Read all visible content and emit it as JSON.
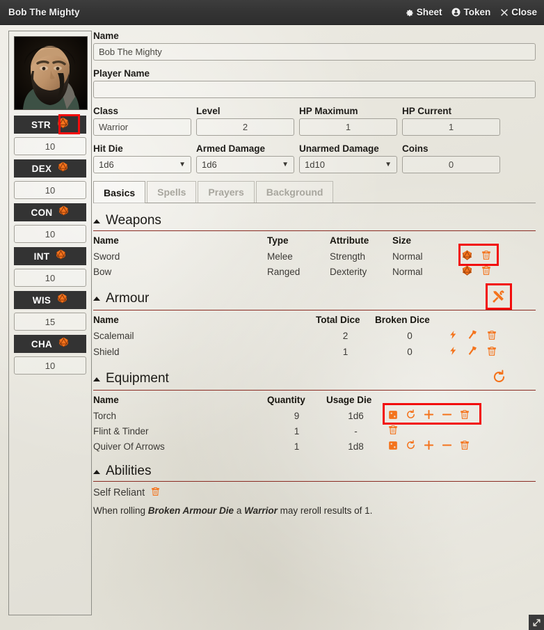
{
  "titlebar": {
    "title": "Bob The Mighty",
    "actions": [
      {
        "label": "Sheet",
        "icon": "gear-icon"
      },
      {
        "label": "Token",
        "icon": "person-icon"
      },
      {
        "label": "Close",
        "icon": "close-icon"
      }
    ]
  },
  "sidebar": {
    "portrait_alt": "character-portrait",
    "stats": [
      {
        "key": "STR",
        "value": "10"
      },
      {
        "key": "DEX",
        "value": "10"
      },
      {
        "key": "CON",
        "value": "10"
      },
      {
        "key": "INT",
        "value": "10"
      },
      {
        "key": "WIS",
        "value": "15"
      },
      {
        "key": "CHA",
        "value": "10"
      }
    ]
  },
  "form": {
    "name_label": "Name",
    "name_value": "Bob The Mighty",
    "player_name_label": "Player Name",
    "player_name_value": "",
    "class_label": "Class",
    "class_value": "Warrior",
    "level_label": "Level",
    "level_value": "2",
    "hp_max_label": "HP Maximum",
    "hp_max_value": "1",
    "hp_current_label": "HP Current",
    "hp_current_value": "1",
    "hit_die_label": "Hit Die",
    "hit_die_value": "1d6",
    "armed_damage_label": "Armed Damage",
    "armed_damage_value": "1d6",
    "unarmed_damage_label": "Unarmed Damage",
    "unarmed_damage_value": "1d10",
    "coins_label": "Coins",
    "coins_value": "0"
  },
  "tabs": [
    {
      "label": "Basics",
      "active": true
    },
    {
      "label": "Spells",
      "active": false
    },
    {
      "label": "Prayers",
      "active": false
    },
    {
      "label": "Background",
      "active": false
    }
  ],
  "weapons": {
    "title": "Weapons",
    "columns": [
      "Name",
      "Type",
      "Attribute",
      "Size"
    ],
    "rows": [
      {
        "name": "Sword",
        "type": "Melee",
        "attribute": "Strength",
        "size": "Normal"
      },
      {
        "name": "Bow",
        "type": "Ranged",
        "attribute": "Dexterity",
        "size": "Normal"
      }
    ]
  },
  "armour": {
    "title": "Armour",
    "columns": [
      "Name",
      "Total Dice",
      "Broken Dice"
    ],
    "rows": [
      {
        "name": "Scalemail",
        "total_dice": "2",
        "broken_dice": "0"
      },
      {
        "name": "Shield",
        "total_dice": "1",
        "broken_dice": "0"
      }
    ]
  },
  "equipment": {
    "title": "Equipment",
    "columns": [
      "Name",
      "Quantity",
      "Usage Die"
    ],
    "rows": [
      {
        "name": "Torch",
        "quantity": "9",
        "usage_die": "1d6",
        "full_icons": true
      },
      {
        "name": "Flint & Tinder",
        "quantity": "1",
        "usage_die": "-",
        "full_icons": false
      },
      {
        "name": "Quiver Of Arrows",
        "quantity": "1",
        "usage_die": "1d8",
        "full_icons": true
      }
    ]
  },
  "abilities": {
    "title": "Abilities",
    "items": [
      {
        "name": "Self Reliant",
        "desc_pre": "When rolling ",
        "desc_b1": "Broken Armour Die",
        "desc_mid": " a ",
        "desc_b2": "Warrior",
        "desc_post": " may reroll results of 1."
      }
    ]
  },
  "colors": {
    "accent_orange": "#f4731c",
    "highlight_red": "#f20d0d",
    "divider_red": "#8a2b22",
    "header_dark": "#333333",
    "parchment": "#e8e6dd"
  }
}
